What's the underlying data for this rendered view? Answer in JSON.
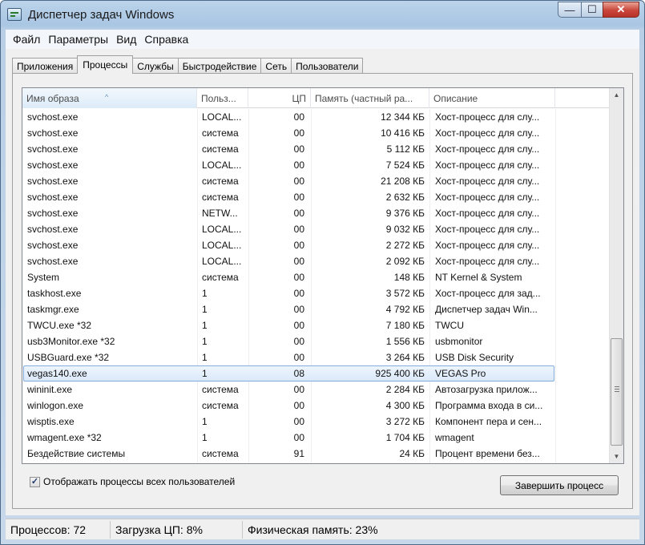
{
  "window": {
    "title": "Диспетчер задач Windows"
  },
  "title_buttons": {
    "minimize": "—",
    "maximize": "☐",
    "close": "✕"
  },
  "menu": [
    "Файл",
    "Параметры",
    "Вид",
    "Справка"
  ],
  "tabs": [
    "Приложения",
    "Процессы",
    "Службы",
    "Быстродействие",
    "Сеть",
    "Пользователи"
  ],
  "active_tab": "Процессы",
  "columns": [
    "Имя образа",
    "Польз...",
    "ЦП",
    "Память (частный ра...",
    "Описание"
  ],
  "sort_indicator": "^",
  "processes": [
    {
      "name": "svchost.exe",
      "user": "LOCAL...",
      "cpu": "00",
      "mem": "12 344 КБ",
      "desc": "Хост-процесс для слу..."
    },
    {
      "name": "svchost.exe",
      "user": "система",
      "cpu": "00",
      "mem": "10 416 КБ",
      "desc": "Хост-процесс для слу..."
    },
    {
      "name": "svchost.exe",
      "user": "система",
      "cpu": "00",
      "mem": "5 112 КБ",
      "desc": "Хост-процесс для слу..."
    },
    {
      "name": "svchost.exe",
      "user": "LOCAL...",
      "cpu": "00",
      "mem": "7 524 КБ",
      "desc": "Хост-процесс для слу..."
    },
    {
      "name": "svchost.exe",
      "user": "система",
      "cpu": "00",
      "mem": "21 208 КБ",
      "desc": "Хост-процесс для слу..."
    },
    {
      "name": "svchost.exe",
      "user": "система",
      "cpu": "00",
      "mem": "2 632 КБ",
      "desc": "Хост-процесс для слу..."
    },
    {
      "name": "svchost.exe",
      "user": "NETW...",
      "cpu": "00",
      "mem": "9 376 КБ",
      "desc": "Хост-процесс для слу..."
    },
    {
      "name": "svchost.exe",
      "user": "LOCAL...",
      "cpu": "00",
      "mem": "9 032 КБ",
      "desc": "Хост-процесс для слу..."
    },
    {
      "name": "svchost.exe",
      "user": "LOCAL...",
      "cpu": "00",
      "mem": "2 272 КБ",
      "desc": "Хост-процесс для слу..."
    },
    {
      "name": "svchost.exe",
      "user": "LOCAL...",
      "cpu": "00",
      "mem": "2 092 КБ",
      "desc": "Хост-процесс для слу..."
    },
    {
      "name": "System",
      "user": "система",
      "cpu": "00",
      "mem": "148 КБ",
      "desc": "NT Kernel & System"
    },
    {
      "name": "taskhost.exe",
      "user": "1",
      "cpu": "00",
      "mem": "3 572 КБ",
      "desc": "Хост-процесс для зад..."
    },
    {
      "name": "taskmgr.exe",
      "user": "1",
      "cpu": "00",
      "mem": "4 792 КБ",
      "desc": "Диспетчер задач Win..."
    },
    {
      "name": "TWCU.exe *32",
      "user": "1",
      "cpu": "00",
      "mem": "7 180 КБ",
      "desc": "TWCU"
    },
    {
      "name": "usb3Monitor.exe *32",
      "user": "1",
      "cpu": "00",
      "mem": "1 556 КБ",
      "desc": "usbmonitor"
    },
    {
      "name": "USBGuard.exe *32",
      "user": "1",
      "cpu": "00",
      "mem": "3 264 КБ",
      "desc": "USB Disk Security"
    },
    {
      "name": "vegas140.exe",
      "user": "1",
      "cpu": "08",
      "mem": "925 400 КБ",
      "desc": "VEGAS Pro",
      "selected": true
    },
    {
      "name": "wininit.exe",
      "user": "система",
      "cpu": "00",
      "mem": "2 284 КБ",
      "desc": "Автозагрузка прилож..."
    },
    {
      "name": "winlogon.exe",
      "user": "система",
      "cpu": "00",
      "mem": "4 300 КБ",
      "desc": "Программа входа в си..."
    },
    {
      "name": "wisptis.exe",
      "user": "1",
      "cpu": "00",
      "mem": "3 272 КБ",
      "desc": "Компонент пера и сен..."
    },
    {
      "name": "wmagent.exe *32",
      "user": "1",
      "cpu": "00",
      "mem": "1 704 КБ",
      "desc": "wmagent"
    },
    {
      "name": "Бездействие системы",
      "user": "система",
      "cpu": "91",
      "mem": "24 КБ",
      "desc": "Процент времени без..."
    }
  ],
  "scrollbar": {
    "position": 1.0
  },
  "show_all_users": {
    "label": "Отображать процессы всех пользователей",
    "checked": true,
    "mark": "✓"
  },
  "end_process_button": "Завершить процесс",
  "status": {
    "processes": "Процессов: 72",
    "cpu": "Загрузка ЦП: 8%",
    "memory": "Физическая память: 23%"
  }
}
